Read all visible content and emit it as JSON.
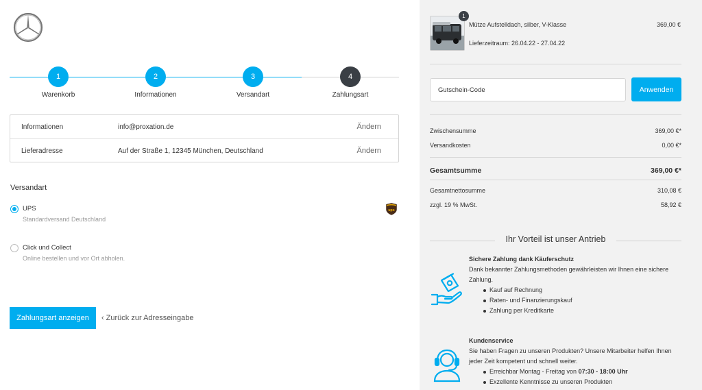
{
  "brand": {
    "logo_icon": "mercedes-star-icon"
  },
  "steps": [
    {
      "number": "1",
      "label": "Warenkorb",
      "state": "done"
    },
    {
      "number": "2",
      "label": "Informationen",
      "state": "done"
    },
    {
      "number": "3",
      "label": "Versandart",
      "state": "done"
    },
    {
      "number": "4",
      "label": "Zahlungsart",
      "state": "current"
    }
  ],
  "summary_box": {
    "rows": [
      {
        "key": "Informationen",
        "value": "info@proxation.de",
        "edit": "Ändern"
      },
      {
        "key": "Lieferadresse",
        "value": "Auf der Straße 1, 12345 München, Deutschland",
        "edit": "Ändern"
      }
    ]
  },
  "shipping": {
    "title": "Versandart",
    "options": [
      {
        "name": "UPS",
        "desc": "Standardversand Deutschland",
        "selected": true,
        "icon": "ups-logo-icon"
      },
      {
        "name": "Click und Collect",
        "desc": "Online bestellen und vor Ort abholen.",
        "selected": false
      }
    ]
  },
  "actions": {
    "primary": "Zahlungsart anzeigen",
    "back": "Zurück zur Adresseingabe"
  },
  "cart": {
    "item": {
      "quantity": "1",
      "name": "Mütze Aufstelldach, silber, V-Klasse",
      "delivery": "Lieferzeitraum: 26.04.22 - 27.04.22",
      "price": "369,00 €"
    },
    "coupon": {
      "placeholder": "Gutschein-Code",
      "button": "Anwenden"
    },
    "totals": {
      "subtotal_label": "Zwischensumme",
      "subtotal": "369,00 €*",
      "shipping_label": "Versandkosten",
      "shipping": "0,00 €*",
      "total_label": "Gesamtsumme",
      "total": "369,00 €*",
      "net_label": "Gesamtnettosumme",
      "net": "310,08 €",
      "vat_label": "zzgl. 19 % MwSt.",
      "vat": "58,92 €"
    }
  },
  "advantages": {
    "title": "Ihr Vorteil ist unser Antrieb",
    "blocks": [
      {
        "icon": "hand-money-icon",
        "heading": "Sichere Zahlung dank Käuferschutz",
        "text": "Dank bekannter Zahlungsmethoden gewährleisten wir Ihnen eine sichere Zahlung.",
        "bullets": [
          "Kauf auf Rechnung",
          "Raten- und Finanzierungskauf",
          "Zahlung per Kreditkarte"
        ]
      },
      {
        "icon": "headset-support-icon",
        "heading": "Kundenservice",
        "text": "Sie haben Fragen zu unseren Produkten? Unsere Mitarbeiter helfen Ihnen jeder Zeit kompetent und schnell weiter.",
        "bullet1_pre": "Erreichbar Montag - Freitag von ",
        "bullet1_bold": "07:30 - 18:00 Uhr",
        "bullet2": "Exzellente Kenntnisse zu unseren Produkten"
      }
    ]
  },
  "colors": {
    "accent": "#00adef",
    "dark": "#3a3f45",
    "panel": "#f2f2f2"
  }
}
